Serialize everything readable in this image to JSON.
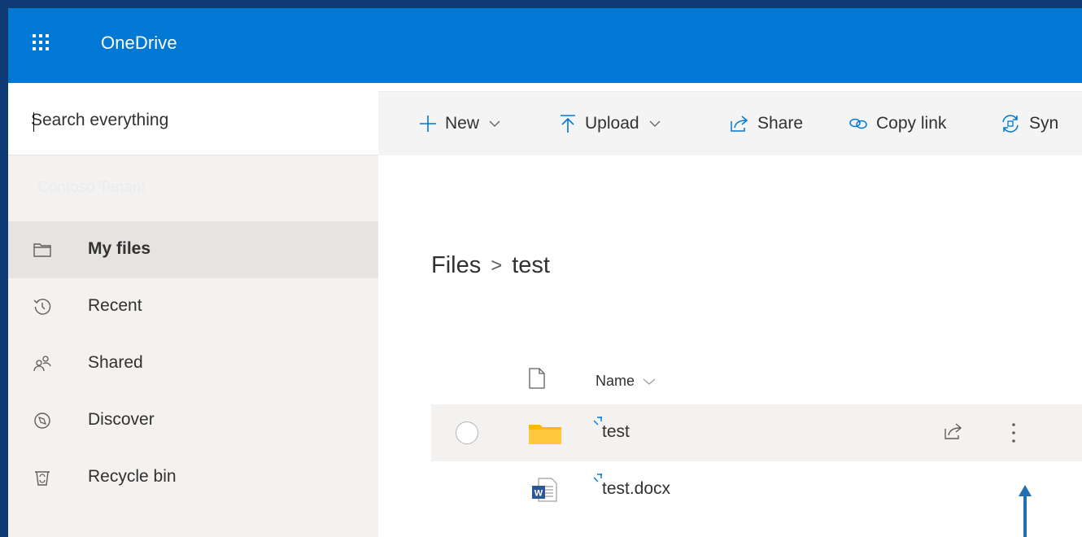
{
  "header": {
    "app_title": "OneDrive",
    "background_color": "#0078d4",
    "waffle_icon": "app-launcher-icon"
  },
  "search": {
    "placeholder": "Search everything"
  },
  "sidebar": {
    "tenant_label": "Contoso Tenant",
    "items": [
      {
        "label": "My files",
        "icon": "folder-icon",
        "selected": true
      },
      {
        "label": "Recent",
        "icon": "history-icon"
      },
      {
        "label": "Shared",
        "icon": "people-icon"
      },
      {
        "label": "Discover",
        "icon": "compass-icon"
      },
      {
        "label": "Recycle bin",
        "icon": "recycle-bin-icon"
      }
    ]
  },
  "command_bar": {
    "new_label": "New",
    "upload_label": "Upload",
    "share_label": "Share",
    "copy_link_label": "Copy link",
    "sync_label": "Syn"
  },
  "breadcrumb": {
    "root": "Files",
    "current": "test"
  },
  "file_list": {
    "name_column": "Name",
    "rows": [
      {
        "name": "test",
        "type": "folder",
        "hovered": true
      },
      {
        "name": "test.docx",
        "type": "word-document"
      }
    ]
  },
  "colors": {
    "accent": "#0078d4",
    "folder": "#ffb900",
    "word": "#2b579a",
    "annotation_arrow": "#1f6fb2"
  }
}
